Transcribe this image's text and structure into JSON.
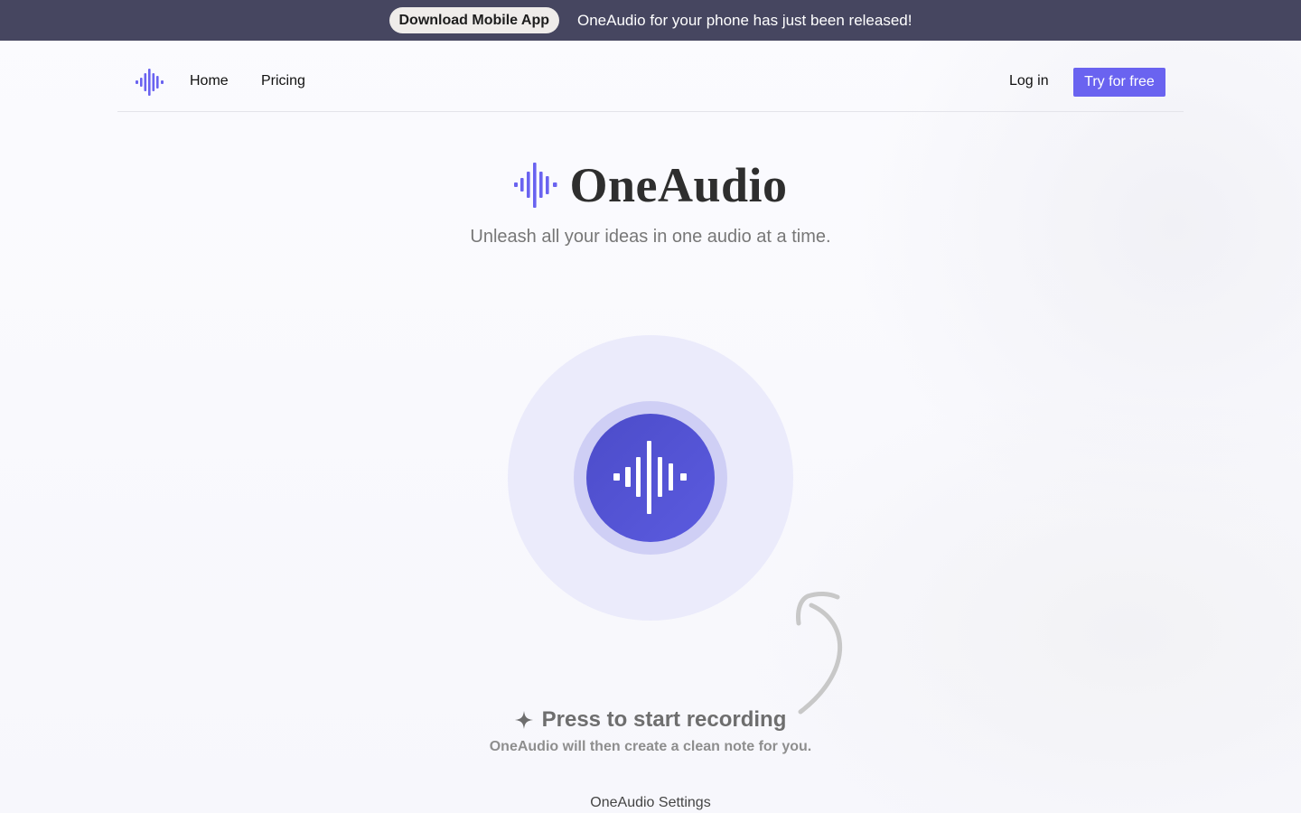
{
  "banner": {
    "button_label": "Download Mobile App",
    "message": "OneAudio for your phone has just been released!"
  },
  "nav": {
    "logo_icon": "waveform-icon",
    "links": [
      "Home",
      "Pricing"
    ],
    "login_label": "Log in",
    "try_label": "Try for free"
  },
  "hero": {
    "brand_name": "OneAudio",
    "tagline": "Unleash all your ideas in one audio at a time.",
    "logo_icon": "waveform-icon"
  },
  "recorder": {
    "icon": "waveform-icon",
    "arrow_icon": "curved-arrow-icon",
    "cta_icon": "sparkle-icon",
    "cta_title": "Press to start recording",
    "cta_subtitle": "OneAudio will then create a clean note for you."
  },
  "footer": {
    "settings_label": "OneAudio Settings"
  },
  "colors": {
    "accent": "#6a63f0",
    "banner_bg": "#464660",
    "record_button": "#5252d4",
    "record_ring_inner": "#cfcff5",
    "record_ring_outer": "#ebebfb"
  }
}
